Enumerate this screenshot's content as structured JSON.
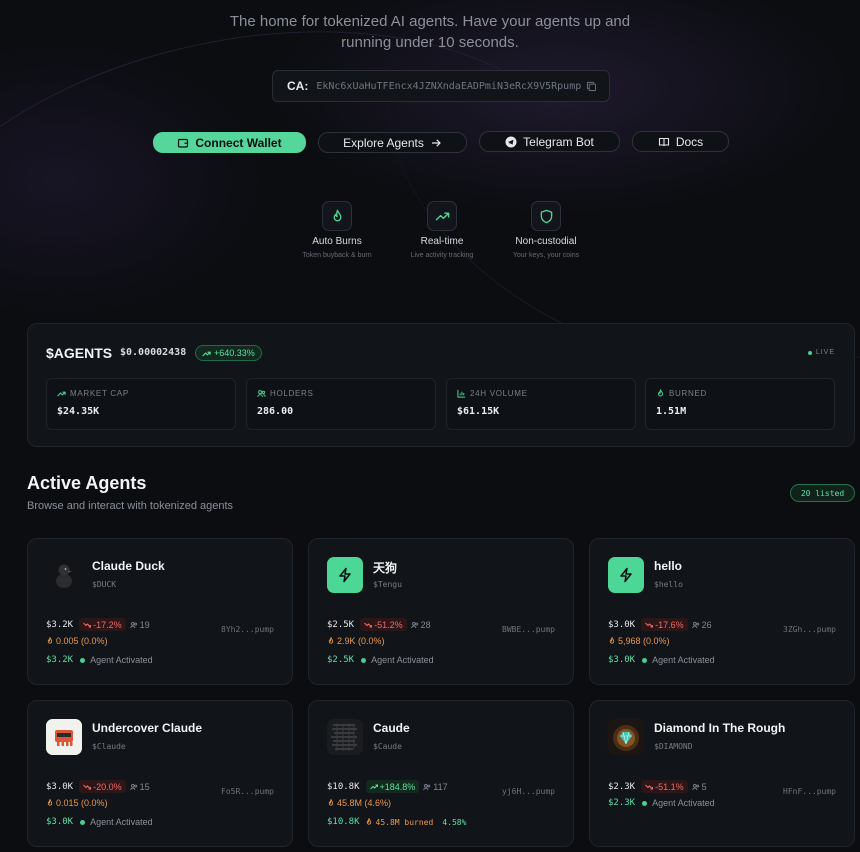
{
  "hero": {
    "tagline_line1": "The home for tokenized AI agents. Have your agents up and",
    "tagline_line2": "running under 10 seconds.",
    "ca_label": "CA:",
    "ca_value": "EkNc6xUaHuTFEncx4JZNXndaEADPmiN3eRcX9V5Rpump"
  },
  "buttons": {
    "connect": "Connect Wallet",
    "explore": "Explore Agents",
    "telegram": "Telegram Bot",
    "docs": "Docs"
  },
  "features": [
    {
      "icon": "flame-icon",
      "title": "Auto Burns",
      "sub": "Token buyback & burn"
    },
    {
      "icon": "trending-up-icon",
      "title": "Real-time",
      "sub": "Live activity tracking"
    },
    {
      "icon": "shield-icon",
      "title": "Non-custodial",
      "sub": "Your keys, your coins"
    }
  ],
  "stats": {
    "title": "$AGENTS",
    "price": "$0.00002438",
    "change": "+640.33%",
    "live": "LIVE",
    "cards": [
      {
        "label": "MARKET CAP",
        "value": "$24.35K",
        "icon": "trending-up-icon"
      },
      {
        "label": "HOLDERS",
        "value": "286.00",
        "icon": "users-icon"
      },
      {
        "label": "24H VOLUME",
        "value": "$61.15K",
        "icon": "bar-chart-icon"
      },
      {
        "label": "BURNED",
        "value": "1.51M",
        "icon": "flame-icon"
      }
    ]
  },
  "section": {
    "title": "Active Agents",
    "subtitle": "Browse and interact with tokenized agents",
    "listed": "20 listed"
  },
  "agents": [
    {
      "name": "Claude Duck",
      "ticker": "$DUCK",
      "mcap": "$3.2K",
      "change": "-17.2%",
      "holders": "19",
      "burn": "0.005 (0.0%)",
      "ca": "8Yh2...pump",
      "status_mcap": "$3.2K",
      "status": "Agent Activated"
    },
    {
      "name": "天狗",
      "ticker": "$Tengu",
      "mcap": "$2.5K",
      "change": "-51.2%",
      "holders": "28",
      "burn": "2.9K (0.0%)",
      "ca": "BWBE...pump",
      "status_mcap": "$2.5K",
      "status": "Agent Activated"
    },
    {
      "name": "hello",
      "ticker": "$hello",
      "mcap": "$3.0K",
      "change": "-17.6%",
      "holders": "26",
      "burn": "5,968 (0.0%)",
      "ca": "3ZGh...pump",
      "status_mcap": "$3.0K",
      "status": "Agent Activated"
    },
    {
      "name": "Undercover Claude",
      "ticker": "$Claude",
      "mcap": "$3.0K",
      "change": "-20.0%",
      "holders": "15",
      "burn": "0.015 (0.0%)",
      "ca": "Fo5R...pump",
      "status_mcap": "$3.0K",
      "status": "Agent Activated"
    },
    {
      "name": "Caude",
      "ticker": "$Caude",
      "mcap": "$10.8K",
      "change": "+184.8%",
      "holders": "117",
      "burn": "45.8M (4.6%)",
      "ca": "yj6H...pump",
      "status_mcap": "$10.8K",
      "burned": "45.8M burned",
      "burned_pct": "4.58%"
    },
    {
      "name": "Diamond In The Rough",
      "ticker": "$DIAMOND",
      "mcap": "$2.3K",
      "change": "-51.1%",
      "holders": "5",
      "ca": "HFnF...pump",
      "status_mcap": "$2.3K",
      "status": "Agent Activated"
    }
  ],
  "colors": {
    "accent_green": "#55d69a",
    "negative_red": "#ef6b6b",
    "burn_orange": "#ec9a4d",
    "background": "#0b0d11"
  }
}
